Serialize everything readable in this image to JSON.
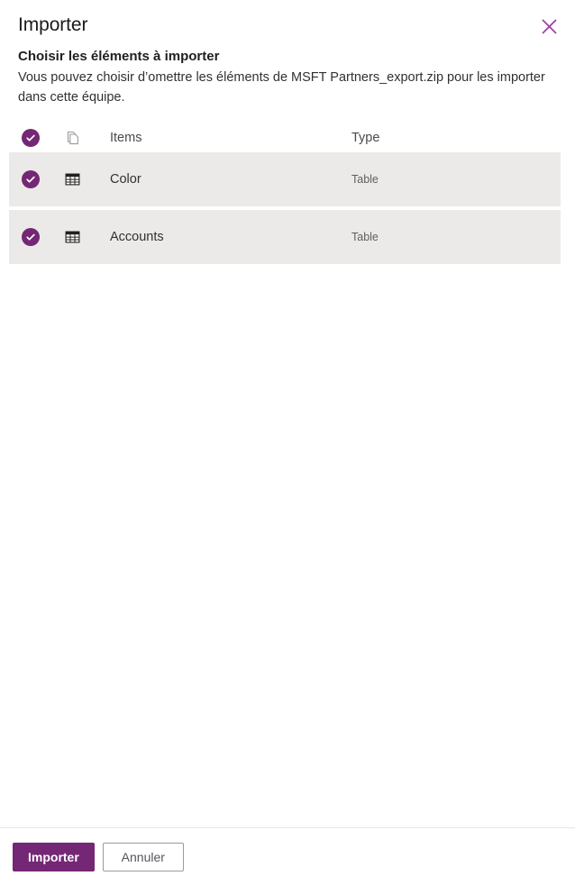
{
  "dialog": {
    "title": "Importer",
    "close_label": "Fermer"
  },
  "section": {
    "heading": "Choisir les éléments à importer",
    "description": "Vous pouvez choisir d’omettre les éléments de MSFT Partners_export.zip pour les importer dans cette équipe."
  },
  "list": {
    "header": {
      "items_label": "Items",
      "type_label": "Type"
    },
    "rows": [
      {
        "name": "Color",
        "type": "Table",
        "selected": true
      },
      {
        "name": "Accounts",
        "type": "Table",
        "selected": true
      }
    ]
  },
  "footer": {
    "primary_label": "Importer",
    "secondary_label": "Annuler"
  },
  "colors": {
    "accent_purple": "#742774",
    "close_icon_purple": "#a33ca3",
    "row_background": "#ebeae8"
  }
}
